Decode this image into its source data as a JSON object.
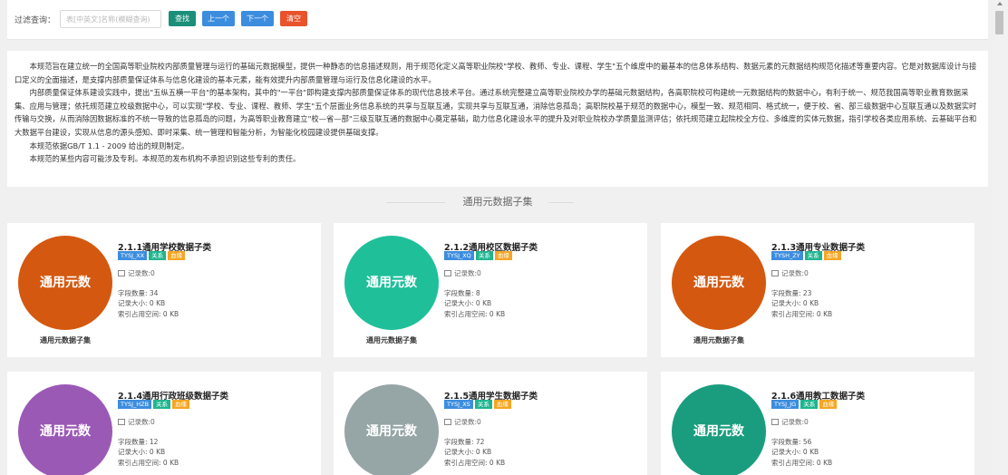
{
  "filter": {
    "label": "过滤查询：",
    "search_placeholder": "表[中英文]名称(模糊查询)",
    "search_value": "",
    "search_button": "查找",
    "prev_button": "上一个",
    "next_button": "下一个",
    "clear_button": "清空"
  },
  "intro": {
    "paragraphs": [
      "本规范旨在建立统一的全国高等职业院校内部质量管理与运行的基础元数据模型，提供一种静态的信息描述规则，用于规范化定义高等职业院校\"学校、教师、专业、课程、学生\"五个维度中的最基本的信息体系结构、数据元素的元数据结构规范化描述等重要内容。它是对数据库设计与接口定义的全面描述，是支撑内部质量保证体系与信息化建设的基本元素，能有效提升内部质量管理与运行及信息化建设的水平。",
      "内部质量保证体系建设实践中，提出\"五纵五横一平台\"的基本架构，其中的\"一平台\"即构建支撑内部质量保证体系的现代信息技术平台。通过系统完整建立高等职业院校办学的基础元数据结构，各高职院校可构建统一元数据结构的数据中心，有利于统一、规范我国高等职业教育数据采集、应用与管理；依托规范建立校级数据中心，可以实现\"学校、专业、课程、教师、学生\"五个层面业务信息系统的共享与互联互通，实现共享与互联互通，消除信息孤岛；高职院校基于规范的数据中心，模型一致、规范相同、格式统一，便于校、省、部三级数据中心互联互通以及数据实时传输与交换，从而消除因数据标准的不统一导致的信息孤岛的问题，为高等职业教育建立\"校—省—部\"三级互联互通的数据中心奠定基础，助力信息化建设水平的提升及对职业院校办学质量监测评估；依托规范建立起院校全方位、多维度的实体元数据，指引学校各类应用系统、云基础平台和大数据平台建设，实现从信息的源头感知、即时采集、统一管理和智能分析，为智能化校园建设提供基础支撑。",
      "本规范依据GB/T 1.1 - 2009 给出的规则制定。",
      "本规范的某些内容可能涉及专利。本规范的发布机构不承担识别这些专利的责任。"
    ]
  },
  "section_title": "通用元数据子集",
  "cards": [
    {
      "circle_text": "通用元数",
      "color": "#d4580f",
      "caption": "通用元数据子集",
      "title": "2.1.1通用学校数据子类",
      "code": "TYSJ_XX",
      "rel": "关系",
      "dict": "血缘",
      "records": "记录数:0",
      "fields": "字段数量: 34",
      "size": "记录大小: 0 KB",
      "index": "索引占用空间: 0 KB"
    },
    {
      "circle_text": "通用元数",
      "color": "#1fbf9a",
      "caption": "通用元数据子集",
      "title": "2.1.2通用校区数据子类",
      "code": "TYSJ_XQ",
      "rel": "关系",
      "dict": "血缘",
      "records": "记录数:0",
      "fields": "字段数量: 8",
      "size": "记录大小: 0 KB",
      "index": "索引占用空间: 0 KB"
    },
    {
      "circle_text": "通用元数",
      "color": "#d4580f",
      "caption": "通用元数据子集",
      "title": "2.1.3通用专业数据子类",
      "code": "TYSH_ZY",
      "rel": "关系",
      "dict": "血缘",
      "records": "记录数:0",
      "fields": "字段数量: 23",
      "size": "记录大小: 0 KB",
      "index": "索引占用空间: 0 KB"
    },
    {
      "circle_text": "通用元数",
      "color": "#9b59b6",
      "caption": "",
      "title": "2.1.4通用行政班级数据子类",
      "code": "TYSJ_HZB",
      "rel": "关系",
      "dict": "血缘",
      "records": "记录数:0",
      "fields": "字段数量: 12",
      "size": "记录大小: 0 KB",
      "index": "索引占用空间: 0 KB"
    },
    {
      "circle_text": "通用元数",
      "color": "#96a5a6",
      "caption": "",
      "title": "2.1.5通用学生数据子类",
      "code": "TYSJ_XS",
      "rel": "关系",
      "dict": "血缘",
      "records": "记录数:0",
      "fields": "字段数量: 72",
      "size": "记录大小: 0 KB",
      "index": "索引占用空间: 0 KB"
    },
    {
      "circle_text": "通用元数",
      "color": "#1a9d7e",
      "caption": "",
      "title": "2.1.6通用教工数据子类",
      "code": "TYSJ_JG",
      "rel": "关系",
      "dict": "血缘",
      "records": "记录数:0",
      "fields": "字段数量: 56",
      "size": "记录大小: 0 KB",
      "index": "索引占用空间: 0 KB"
    }
  ]
}
